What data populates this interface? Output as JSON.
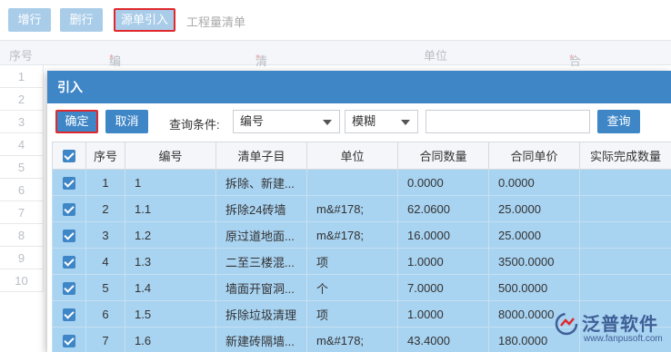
{
  "toolbar": {
    "add_row": "增行",
    "delete_row": "删行",
    "import_source": "源单引入",
    "tab": "工程量清单"
  },
  "grid_header": {
    "seq": "序号",
    "code": "编号",
    "item": "清单子目",
    "unit": "单位",
    "qty": "合同数量",
    "required_mark": "*"
  },
  "grid_row_numbers": [
    "1",
    "2",
    "3",
    "4",
    "5",
    "6",
    "7",
    "8",
    "9",
    "10"
  ],
  "dialog": {
    "title": "引入",
    "confirm": "确定",
    "cancel": "取消",
    "query_label": "查询条件:",
    "field_select": "编号",
    "match_select": "模糊",
    "query_input_value": "",
    "query_button": "查询",
    "columns": [
      "序号",
      "编号",
      "清单子目",
      "单位",
      "合同数量",
      "合同单价",
      "实际完成数量"
    ],
    "rows": [
      {
        "seq": "1",
        "code": "1",
        "item": "拆除、新建...",
        "unit": "",
        "qty": "0.0000",
        "price": "0.0000",
        "done": ""
      },
      {
        "seq": "2",
        "code": "1.1",
        "item": "拆除24砖墙",
        "unit": "m&#178;",
        "qty": "62.0600",
        "price": "25.0000",
        "done": ""
      },
      {
        "seq": "3",
        "code": "1.2",
        "item": "原过道地面...",
        "unit": "m&#178;",
        "qty": "16.0000",
        "price": "25.0000",
        "done": ""
      },
      {
        "seq": "4",
        "code": "1.3",
        "item": "二至三楼混...",
        "unit": "项",
        "qty": "1.0000",
        "price": "3500.0000",
        "done": ""
      },
      {
        "seq": "5",
        "code": "1.4",
        "item": "墙面开窗洞...",
        "unit": "个",
        "qty": "7.0000",
        "price": "500.0000",
        "done": ""
      },
      {
        "seq": "6",
        "code": "1.5",
        "item": "拆除垃圾清理",
        "unit": "项",
        "qty": "1.0000",
        "price": "8000.0000",
        "done": ""
      },
      {
        "seq": "7",
        "code": "1.6",
        "item": "新建砖隔墙...",
        "unit": "m&#178;",
        "qty": "43.4000",
        "price": "180.0000",
        "done": ""
      }
    ]
  },
  "watermark": {
    "brand": "泛普软件",
    "url": "www.fanpusoft.com"
  },
  "colors": {
    "primary": "#3f86c7",
    "primary_light": "#a9cce9",
    "selected_row": "#a8d3f1",
    "highlight_border": "#e0282d"
  }
}
